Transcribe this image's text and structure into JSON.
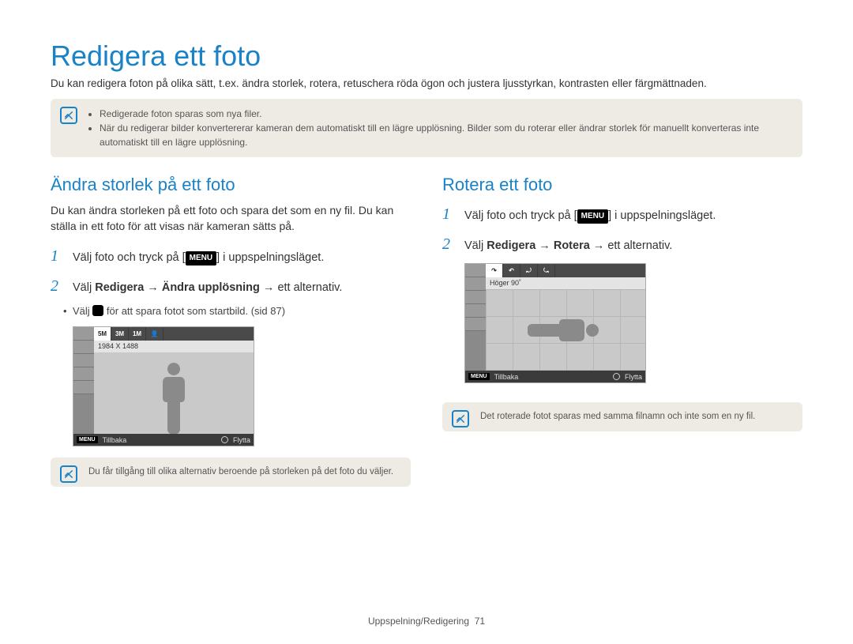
{
  "page": {
    "title": "Redigera ett foto",
    "intro": "Du kan redigera foton på olika sätt, t.ex. ändra storlek, rotera, retuschera röda ögon och justera ljusstyrkan, kontrasten eller färgmättnaden.",
    "footer_section": "Uppspelning/Redigering",
    "footer_page": "71"
  },
  "top_note": {
    "items": [
      "Redigerade foton sparas som nya filer.",
      "När du redigerar bilder konvertererar kameran dem automatiskt till en lägre upplösning. Bilder som du roterar eller ändrar storlek för manuellt konverteras inte automatiskt till en lägre upplösning."
    ]
  },
  "left": {
    "heading": "Ändra storlek på ett foto",
    "para": "Du kan ändra storleken på ett foto och spara det som en ny fil. Du kan ställa in ett foto för att visas när kameran sätts på.",
    "step1_pre": "Välj foto och tryck på [",
    "step1_badge": "MENU",
    "step1_post": "] i uppspelningsläget.",
    "step2_pre": "Välj ",
    "step2_b1": "Redigera",
    "step2_arrow": " → ",
    "step2_b2": "Ändra upplösning",
    "step2_post": " → ett alternativ.",
    "sub_pre": "Välj ",
    "sub_post": " för att spara fotot som startbild. (sid 87)",
    "cam": {
      "top_tabs": [
        "5M",
        "3M",
        "1M",
        "👤"
      ],
      "label": "1984 X 1488",
      "footer_back": "Tillbaka",
      "footer_move": "Flytta"
    },
    "note": "Du får tillgång till olika alternativ beroende på storleken på det foto du väljer."
  },
  "right": {
    "heading": "Rotera ett foto",
    "step1_pre": "Välj foto och tryck på [",
    "step1_badge": "MENU",
    "step1_post": "] i uppspelningsläget.",
    "step2_pre": "Välj ",
    "step2_b1": "Redigera",
    "step2_arrow": " → ",
    "step2_b2": "Rotera",
    "step2_post": " → ett alternativ.",
    "cam": {
      "label": "Höger 90˚",
      "footer_back": "Tillbaka",
      "footer_move": "Flytta"
    },
    "note": "Det roterade fotot sparas med samma filnamn och inte som en ny fil."
  }
}
